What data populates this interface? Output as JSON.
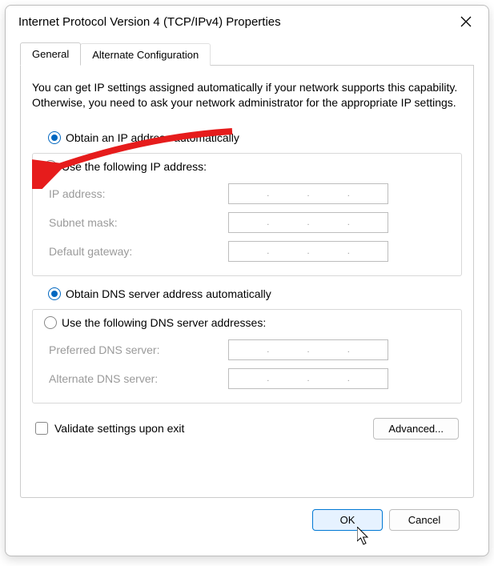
{
  "window": {
    "title": "Internet Protocol Version 4 (TCP/IPv4) Properties"
  },
  "tabs": {
    "general": "General",
    "alternate": "Alternate Configuration"
  },
  "description": "You can get IP settings assigned automatically if your network supports this capability. Otherwise, you need to ask your network administrator for the appropriate IP settings.",
  "ip_section": {
    "obtain_auto": "Obtain an IP address automatically",
    "use_following": "Use the following IP address:",
    "ip_address": "IP address:",
    "subnet_mask": "Subnet mask:",
    "default_gateway": "Default gateway:"
  },
  "dns_section": {
    "obtain_auto": "Obtain DNS server address automatically",
    "use_following": "Use the following DNS server addresses:",
    "preferred": "Preferred DNS server:",
    "alternate": "Alternate DNS server:"
  },
  "validate_checkbox": "Validate settings upon exit",
  "buttons": {
    "advanced": "Advanced...",
    "ok": "OK",
    "cancel": "Cancel"
  }
}
